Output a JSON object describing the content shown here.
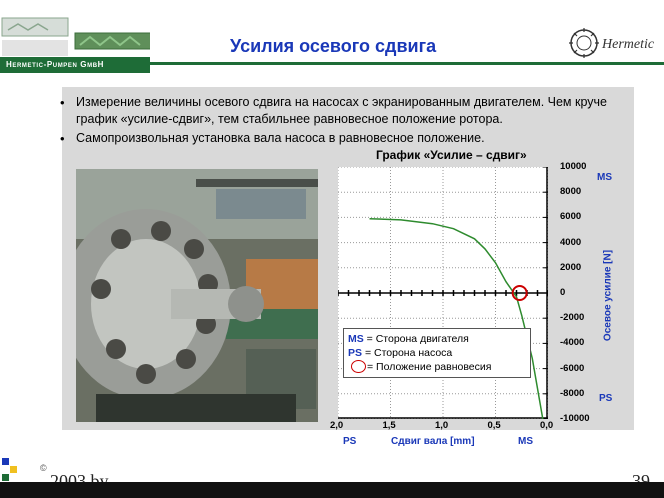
{
  "brand": {
    "company": "Hermetic-Pumpen GmbH",
    "logo_text": "Hermetic"
  },
  "slide": {
    "title": "Усилия осевого сдвига"
  },
  "bullets": [
    "Измерение величины осевого сдвига на насосах с экранированным двигателем. Чем круче график «усилие-сдвиг», тем стабильнее равновесное положение ротора.",
    "Самопроизвольная установка вала насоса в равновесное положение."
  ],
  "chart_data": {
    "type": "line",
    "title": "График «Усилие – сдвиг»",
    "xlabel": "Сдвиг вала [mm]",
    "ylabel": "Осевое усилие [N]",
    "xlim": [
      2.0,
      0.0
    ],
    "ylim": [
      -10000,
      10000
    ],
    "x_ticks": [
      "2,0",
      "1,5",
      "1,0",
      "0,5",
      "0,0"
    ],
    "y_ticks": [
      "10000",
      "8000",
      "6000",
      "4000",
      "2000",
      "0",
      "-2000",
      "-4000",
      "-6000",
      "-8000",
      "-10000"
    ],
    "x_end_labels": {
      "left": "PS",
      "right": "MS"
    },
    "y_end_labels": {
      "top": "MS",
      "bottom": "PS"
    },
    "grid": true,
    "series": [
      {
        "x": [
          1.7,
          1.4,
          1.1,
          0.9,
          0.7,
          0.6,
          0.5,
          0.4,
          0.3,
          0.25,
          0.15,
          0.05
        ],
        "y": [
          5900,
          5800,
          5500,
          5100,
          4300,
          3500,
          2400,
          900,
          -300,
          -1800,
          -5200,
          -10000
        ]
      }
    ],
    "equilibrium": {
      "x": 0.27,
      "y": 0
    },
    "line_color": "#2e8b2e"
  },
  "legend": {
    "ms_abbr": "MS",
    "ms_text": "= Сторона двигателя",
    "ps_abbr": "PS",
    "ps_text": "= Сторона насоса",
    "eq_text": "= Положение равновесия"
  },
  "footer": {
    "copyright": "©",
    "text": "2003 by",
    "page": "39"
  }
}
